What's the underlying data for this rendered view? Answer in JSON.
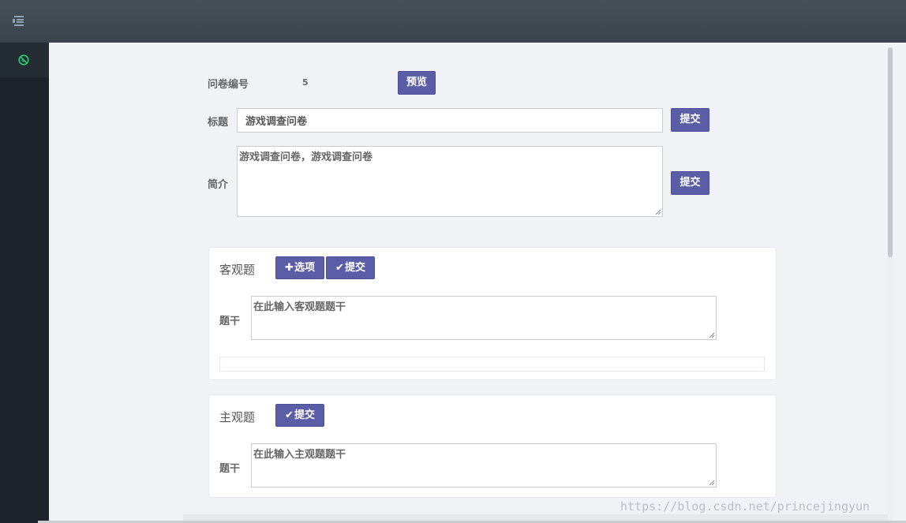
{
  "header": {
    "menu_icon": "menu-icon"
  },
  "sidebar": {
    "active_icon": "compass-icon",
    "active_color": "#2ecc71"
  },
  "form": {
    "id_label": "问卷编号",
    "id_value": "5",
    "preview_button": "预览",
    "title_label": "标题",
    "title_value": "游戏调查问卷",
    "title_submit": "提交",
    "intro_label": "简介",
    "intro_value": "游戏调查问卷，游戏调查问卷",
    "intro_submit": "提交"
  },
  "objective": {
    "title": "客观题",
    "add_option_button": "选项",
    "submit_button": "提交",
    "stem_label": "题干",
    "stem_placeholder": "在此输入客观题题干"
  },
  "subjective": {
    "title": "主观题",
    "submit_button": "提交",
    "stem_label": "题干",
    "stem_placeholder": "在此输入主观题题干"
  },
  "watermark": "https://blog.csdn.net/princejingyun",
  "colors": {
    "accent": "#5b5ea6",
    "topbar": "#3f4951",
    "sidebar": "#1d232a"
  }
}
